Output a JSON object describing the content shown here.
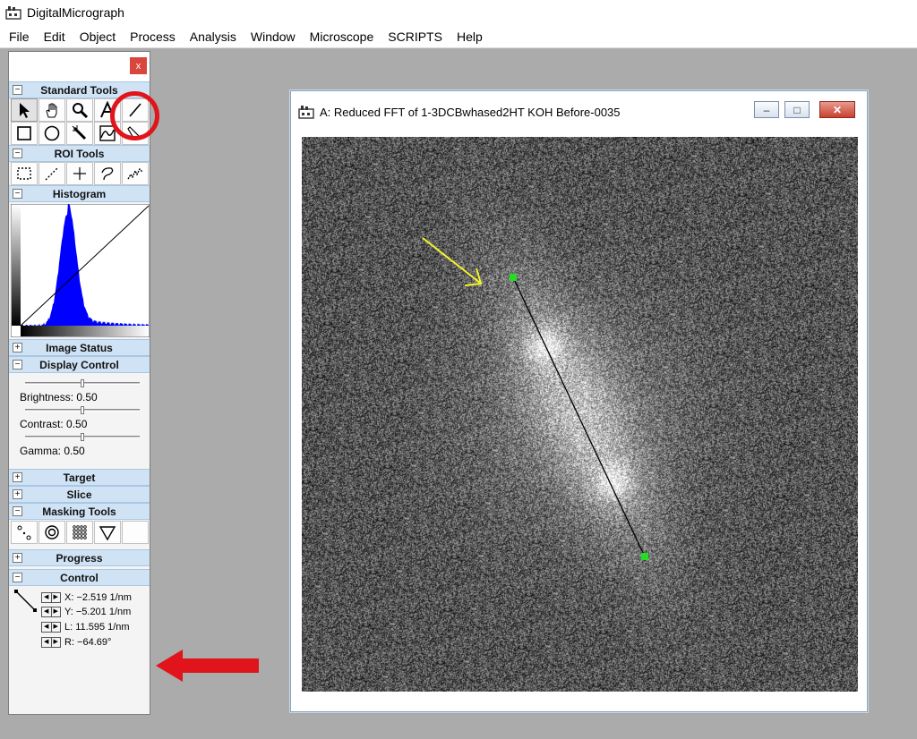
{
  "app": {
    "title": "DigitalMicrograph",
    "icon": "digitalmicrograph-app-icon"
  },
  "menu": [
    "File",
    "Edit",
    "Object",
    "Process",
    "Analysis",
    "Window",
    "Microscope",
    "SCRIPTS",
    "Help"
  ],
  "palette": {
    "close_label": "x",
    "sections": {
      "standard_tools": "Standard Tools",
      "roi_tools": "ROI Tools",
      "histogram": "Histogram",
      "image_status": "Image Status",
      "display_control": "Display Control",
      "target": "Target",
      "slice": "Slice",
      "masking_tools": "Masking Tools",
      "progress": "Progress",
      "control": "Control"
    },
    "standard_tools_row1": [
      "arrow-select-icon",
      "hand-pan-icon",
      "magnifier-icon",
      "text-tool-icon",
      "line-tool-icon"
    ],
    "standard_tools_row2": [
      "rectangle-tool-icon",
      "oval-tool-icon",
      "magic-wand-icon",
      "profile-tool-icon",
      "pencil-tool-icon"
    ],
    "roi_tools": [
      "rect-roi-icon",
      "line-roi-icon",
      "point-roi-icon",
      "lasso-roi-icon",
      "profile-roi-icon"
    ],
    "masking_tools": [
      "point-mask-icon",
      "ring-mask-icon",
      "array-mask-icon",
      "wedge-mask-icon",
      "blank-mask-icon"
    ],
    "selected_tool": "line-tool-icon",
    "display_control": {
      "brightness": "Brightness: 0.50",
      "contrast": "Contrast: 0.50",
      "gamma": "Gamma: 0.50",
      "brightness_value": 0.5,
      "contrast_value": 0.5,
      "gamma_value": 0.5
    },
    "control": {
      "x": "X: −2.519 1/nm",
      "y": "Y: −5.201 1/nm",
      "l": "L: 11.595 1/nm",
      "r": "R: −64.69°"
    }
  },
  "image_window": {
    "title": "A: Reduced FFT of 1-3DCBwhased2HT KOH Before-0035",
    "minimize_label": "–",
    "restore_label": "□",
    "close_label": "✕"
  },
  "colors": {
    "histogram_fill": "#0000ff",
    "line_endpoint": "#22dd22",
    "annotation_red": "#e0141a",
    "annotation_yellow": "#f5f52a",
    "section_header": "#cfe3f5"
  }
}
